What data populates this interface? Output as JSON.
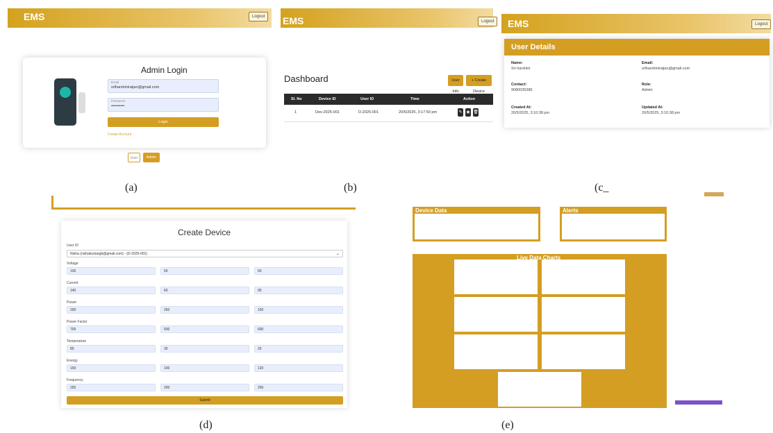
{
  "panels": {
    "a": {
      "brand": "EMS",
      "logout": "Logout",
      "title": "Admin Login",
      "email_label": "Email",
      "email_value": "srlharshiniraijan@gmail.com",
      "password_label": "Password",
      "password_value": "••••••••••",
      "login_label": "Login",
      "create_account": "Create Account",
      "toggle_user": "User",
      "toggle_admin": "Admin",
      "caption": "(a)"
    },
    "b": {
      "brand": "EMS",
      "logout": "Logout",
      "title": "Dashboard",
      "user_info_btn": "User Info",
      "create_device_btn": "+ Create Device",
      "columns": [
        "Sl. No",
        "Device ID",
        "User ID",
        "Time",
        "Action"
      ],
      "rows": [
        {
          "sl": "1",
          "device_id": "Dev-2025-001",
          "user_id": "D-2025-001",
          "time": "20/5/2025, 3:17:50 pm"
        }
      ],
      "caption": "(b)"
    },
    "c": {
      "brand": "EMS",
      "logout": "Logout",
      "title": "User Details",
      "name_label": "Name:",
      "name_value": "Sri harshini",
      "email_label": "Email:",
      "email_value": "srlharshiniraijan@gmail.com",
      "contact_label": "Contact:",
      "contact_value": "9080035386",
      "role_label": "Role:",
      "role_value": "Admin",
      "created_label": "Created At:",
      "created_value": "20/5/2025, 3:10:38 pm",
      "updated_label": "Updated At:",
      "updated_value": "20/5/2025, 3:10:38 pm",
      "caption": "(c_"
    },
    "d": {
      "title": "Create Device",
      "user_id_label": "User ID",
      "user_id_value": "Nisha (nishakumargb@gmail.com) - (D-2025-001)",
      "fields": [
        {
          "label": "Voltage",
          "values": [
            "100",
            "50",
            "60"
          ]
        },
        {
          "label": "Current",
          "values": [
            "140",
            "60",
            "90"
          ]
        },
        {
          "label": "Power",
          "values": [
            "200",
            "250",
            "150"
          ]
        },
        {
          "label": "Power Factor",
          "values": [
            "700",
            "500",
            "600"
          ]
        },
        {
          "label": "Temperature",
          "values": [
            "80",
            "30",
            "20"
          ]
        },
        {
          "label": "Energy",
          "values": [
            "150",
            "100",
            "120"
          ]
        },
        {
          "label": "Frequency",
          "values": [
            "250",
            "200",
            "250"
          ]
        }
      ],
      "submit": "Submit",
      "caption": "(d)"
    },
    "e": {
      "device_data_title": "Device Data",
      "alerts_title": "Alerts",
      "live_charts_title": "Live Data Charts",
      "caption": "(e)"
    }
  },
  "colors": {
    "accent": "#d49e23",
    "header_dark": "#2b2b2b",
    "input_bg": "#e8eefc"
  }
}
